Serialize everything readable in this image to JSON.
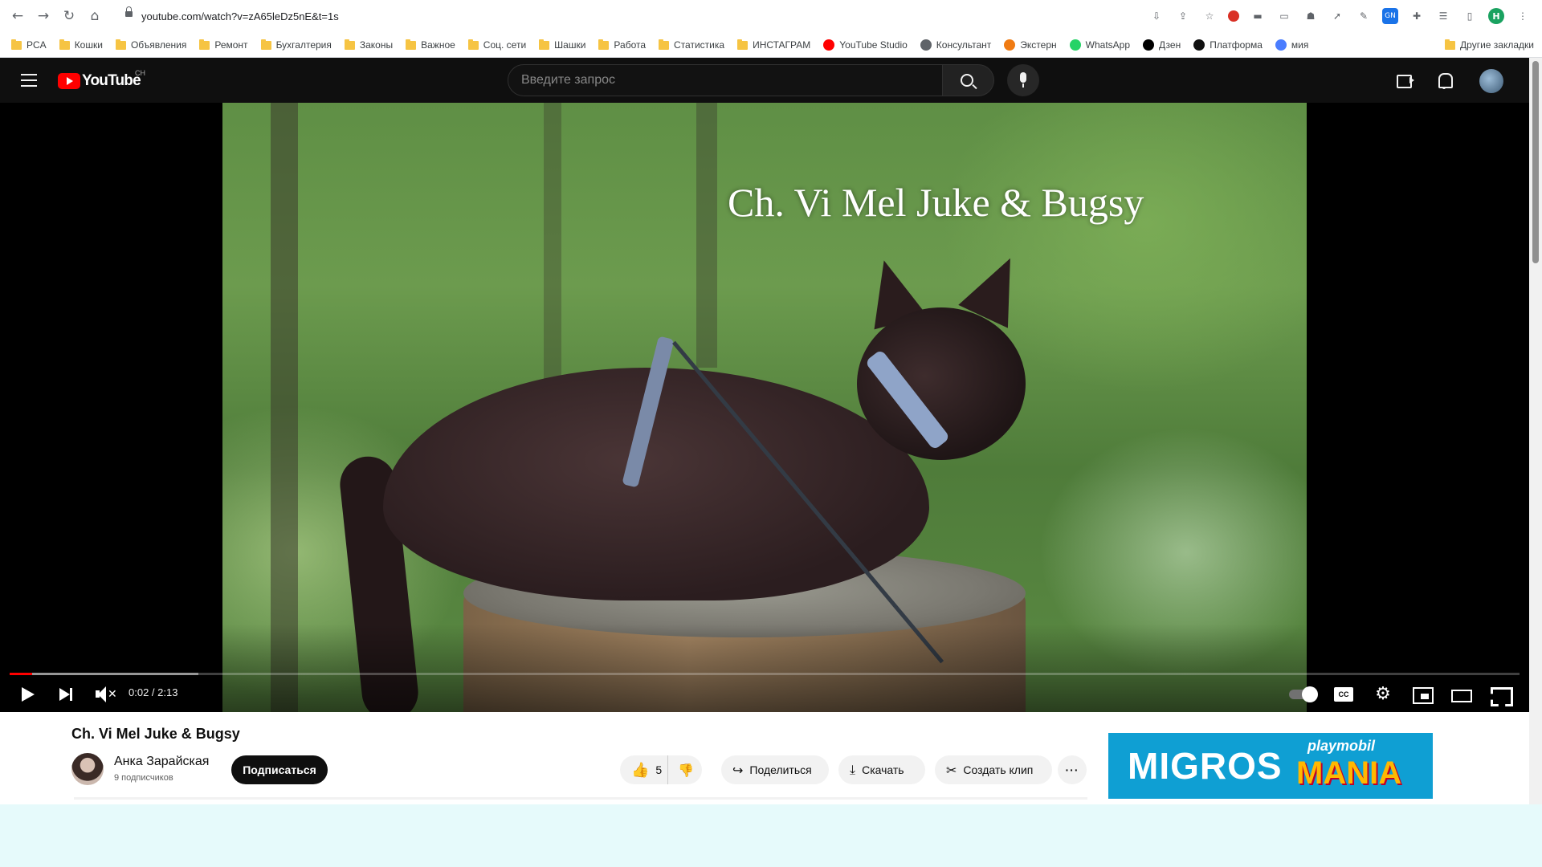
{
  "browser": {
    "url": "youtube.com/watch?v=zA65leDz5nE&t=1s",
    "bookmarks": [
      {
        "label": "PCA",
        "icon": "folder-icon"
      },
      {
        "label": "Кошки",
        "icon": "folder-icon"
      },
      {
        "label": "Объявления",
        "icon": "folder-icon"
      },
      {
        "label": "Ремонт",
        "icon": "folder-icon"
      },
      {
        "label": "Бухгалтерия",
        "icon": "folder-icon"
      },
      {
        "label": "Законы",
        "icon": "folder-icon"
      },
      {
        "label": "Важное",
        "icon": "folder-icon"
      },
      {
        "label": "Соц. сети",
        "icon": "folder-icon"
      },
      {
        "label": "Шашки",
        "icon": "folder-icon"
      },
      {
        "label": "Работа",
        "icon": "folder-icon"
      },
      {
        "label": "Статистика",
        "icon": "folder-icon"
      },
      {
        "label": "ИНСТАГРАМ",
        "icon": "folder-icon"
      },
      {
        "label": "YouTube Studio",
        "icon": "youtube-studio-icon",
        "color": "#ff0000"
      },
      {
        "label": "Консультант",
        "icon": "chat-icon",
        "color": "#5f6368"
      },
      {
        "label": "Экстерн",
        "icon": "check-icon",
        "color": "#f07b12"
      },
      {
        "label": "WhatsApp",
        "icon": "whatsapp-icon",
        "color": "#25d366"
      },
      {
        "label": "Дзен",
        "icon": "dzen-icon",
        "color": "#000000"
      },
      {
        "label": "Платформа",
        "icon": "platform-icon",
        "color": "#111111"
      },
      {
        "label": "мия",
        "icon": "u-icon",
        "color": "#4a7dff"
      }
    ],
    "other_bookmarks": "Другие закладки",
    "profile_initial": "H"
  },
  "youtube": {
    "logo_text": "YouTube",
    "country_code": "CH",
    "search_placeholder": "Введите запрос"
  },
  "player": {
    "overlay_title": "Ch. Vi Mel Juke & Bugsy",
    "time": "0:02 / 2:13",
    "played_fraction": 0.015,
    "buffered_fraction": 0.125
  },
  "video": {
    "title": "Ch. Vi Mel Juke & Bugsy",
    "channel_name": "Анка Зарайская",
    "subscribers": "9 подписчиков",
    "subscribe_label": "Подписаться",
    "like_count": "5",
    "share_label": "Поделиться",
    "download_label": "Скачать",
    "clip_label": "Создать клип",
    "more_label": "···"
  },
  "ad": {
    "brand": "MIGROS",
    "subbrand_top": "playmobil",
    "subbrand_bottom": "MANIA"
  },
  "colors": {
    "youtube_red": "#ff0000",
    "masthead_bg": "#0f0f0f",
    "ad_bg": "#0f9fd3",
    "page_bg_below": "#e6fafb"
  }
}
